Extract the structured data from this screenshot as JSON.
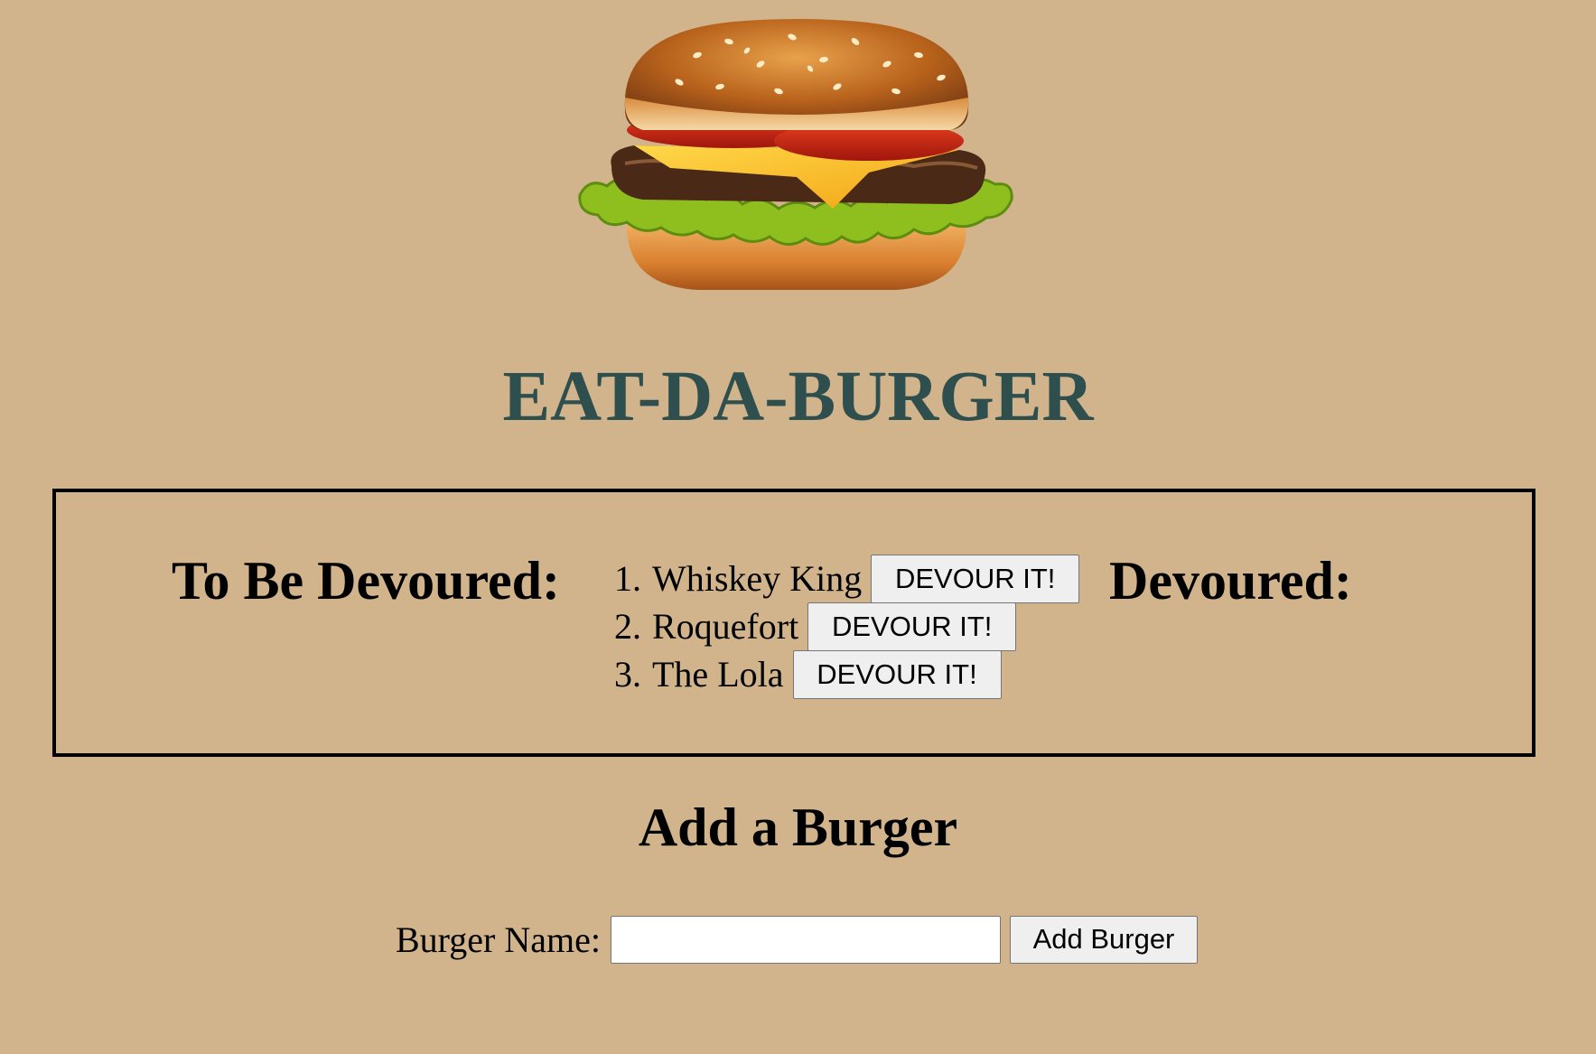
{
  "header": {
    "title": "EAT-DA-BURGER",
    "logo_icon": "hamburger-icon"
  },
  "lists": {
    "to_devour_heading": "To Be Devoured:",
    "devoured_heading": "Devoured:",
    "to_devour": [
      {
        "number": "1.",
        "name": "Whiskey King",
        "button_label": "DEVOUR IT!"
      },
      {
        "number": "2.",
        "name": "Roquefort",
        "button_label": "DEVOUR IT!"
      },
      {
        "number": "3.",
        "name": "The Lola",
        "button_label": "DEVOUR IT!"
      }
    ],
    "devoured": []
  },
  "add_form": {
    "heading": "Add a Burger",
    "label": "Burger Name:",
    "input_value": "",
    "submit_label": "Add Burger"
  },
  "colors": {
    "background": "#d2b48c",
    "title": "#2f4f4f"
  }
}
